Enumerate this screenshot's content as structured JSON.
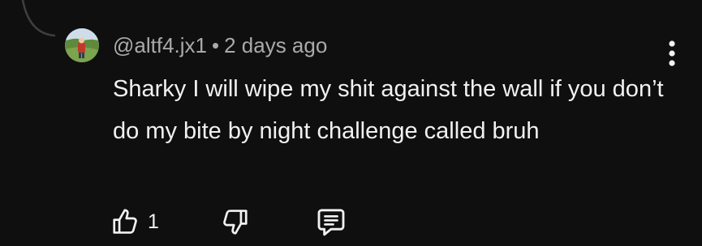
{
  "comment": {
    "author": "@altf4.jx1",
    "separator": "•",
    "timestamp": "2 days ago",
    "text": "Sharky I will wipe my shit against the wall if you don’t do my bite by night challenge called bruh"
  },
  "actions": {
    "like_count": "1",
    "like_icon": "thumbs-up-icon",
    "dislike_icon": "thumbs-down-icon",
    "reply_icon": "reply-icon",
    "more_icon": "more-vert-icon"
  },
  "colors": {
    "background": "#0f0f0f",
    "text_primary": "#f1f1f1",
    "text_secondary": "#aaaaaa",
    "thread_line": "#3f3f3f"
  }
}
